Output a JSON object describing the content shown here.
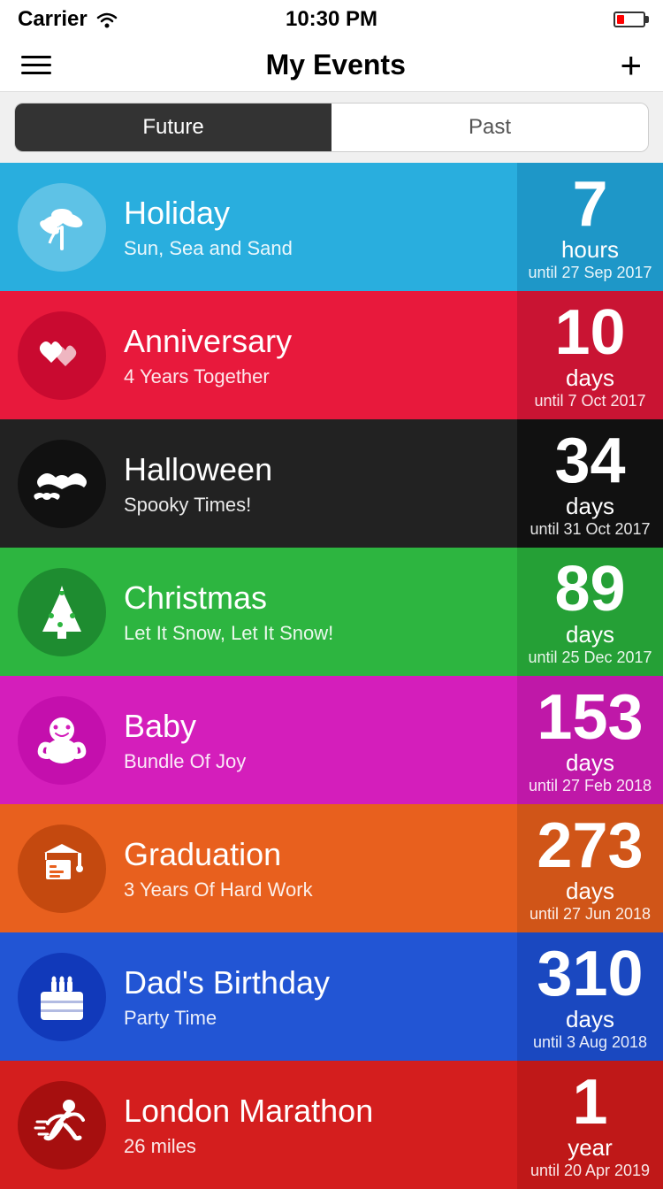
{
  "statusBar": {
    "carrier": "Carrier",
    "time": "10:30 PM"
  },
  "navBar": {
    "title": "My Events",
    "addLabel": "+"
  },
  "segmentControl": {
    "options": [
      "Future",
      "Past"
    ],
    "activeIndex": 0
  },
  "events": [
    {
      "id": "holiday",
      "name": "Holiday",
      "subtitle": "Sun, Sea and Sand",
      "number": "7",
      "unit": "hours",
      "date": "until 27 Sep 2017",
      "colorClass": "event-holiday",
      "iconCircleClass": "holiday-circle"
    },
    {
      "id": "anniversary",
      "name": "Anniversary",
      "subtitle": "4 Years Together",
      "number": "10",
      "unit": "days",
      "date": "until 7 Oct 2017",
      "colorClass": "event-anniversary",
      "iconCircleClass": "anniversary-circle"
    },
    {
      "id": "halloween",
      "name": "Halloween",
      "subtitle": "Spooky Times!",
      "number": "34",
      "unit": "days",
      "date": "until 31 Oct 2017",
      "colorClass": "event-halloween",
      "iconCircleClass": "halloween-circle"
    },
    {
      "id": "christmas",
      "name": "Christmas",
      "subtitle": "Let It Snow, Let It Snow!",
      "number": "89",
      "unit": "days",
      "date": "until 25 Dec 2017",
      "colorClass": "event-christmas",
      "iconCircleClass": "christmas-circle"
    },
    {
      "id": "baby",
      "name": "Baby",
      "subtitle": "Bundle Of Joy",
      "number": "153",
      "unit": "days",
      "date": "until 27 Feb 2018",
      "colorClass": "event-baby",
      "iconCircleClass": "baby-circle"
    },
    {
      "id": "graduation",
      "name": "Graduation",
      "subtitle": "3 Years Of Hard Work",
      "number": "273",
      "unit": "days",
      "date": "until 27 Jun 2018",
      "colorClass": "event-graduation",
      "iconCircleClass": "graduation-circle"
    },
    {
      "id": "birthday",
      "name": "Dad's Birthday",
      "subtitle": "Party Time",
      "number": "310",
      "unit": "days",
      "date": "until 3 Aug 2018",
      "colorClass": "event-birthday",
      "iconCircleClass": "birthday-circle"
    },
    {
      "id": "marathon",
      "name": "London Marathon",
      "subtitle": "26 miles",
      "number": "1",
      "unit": "year",
      "date": "until 20 Apr 2019",
      "colorClass": "event-marathon",
      "iconCircleClass": "marathon-circle"
    }
  ]
}
